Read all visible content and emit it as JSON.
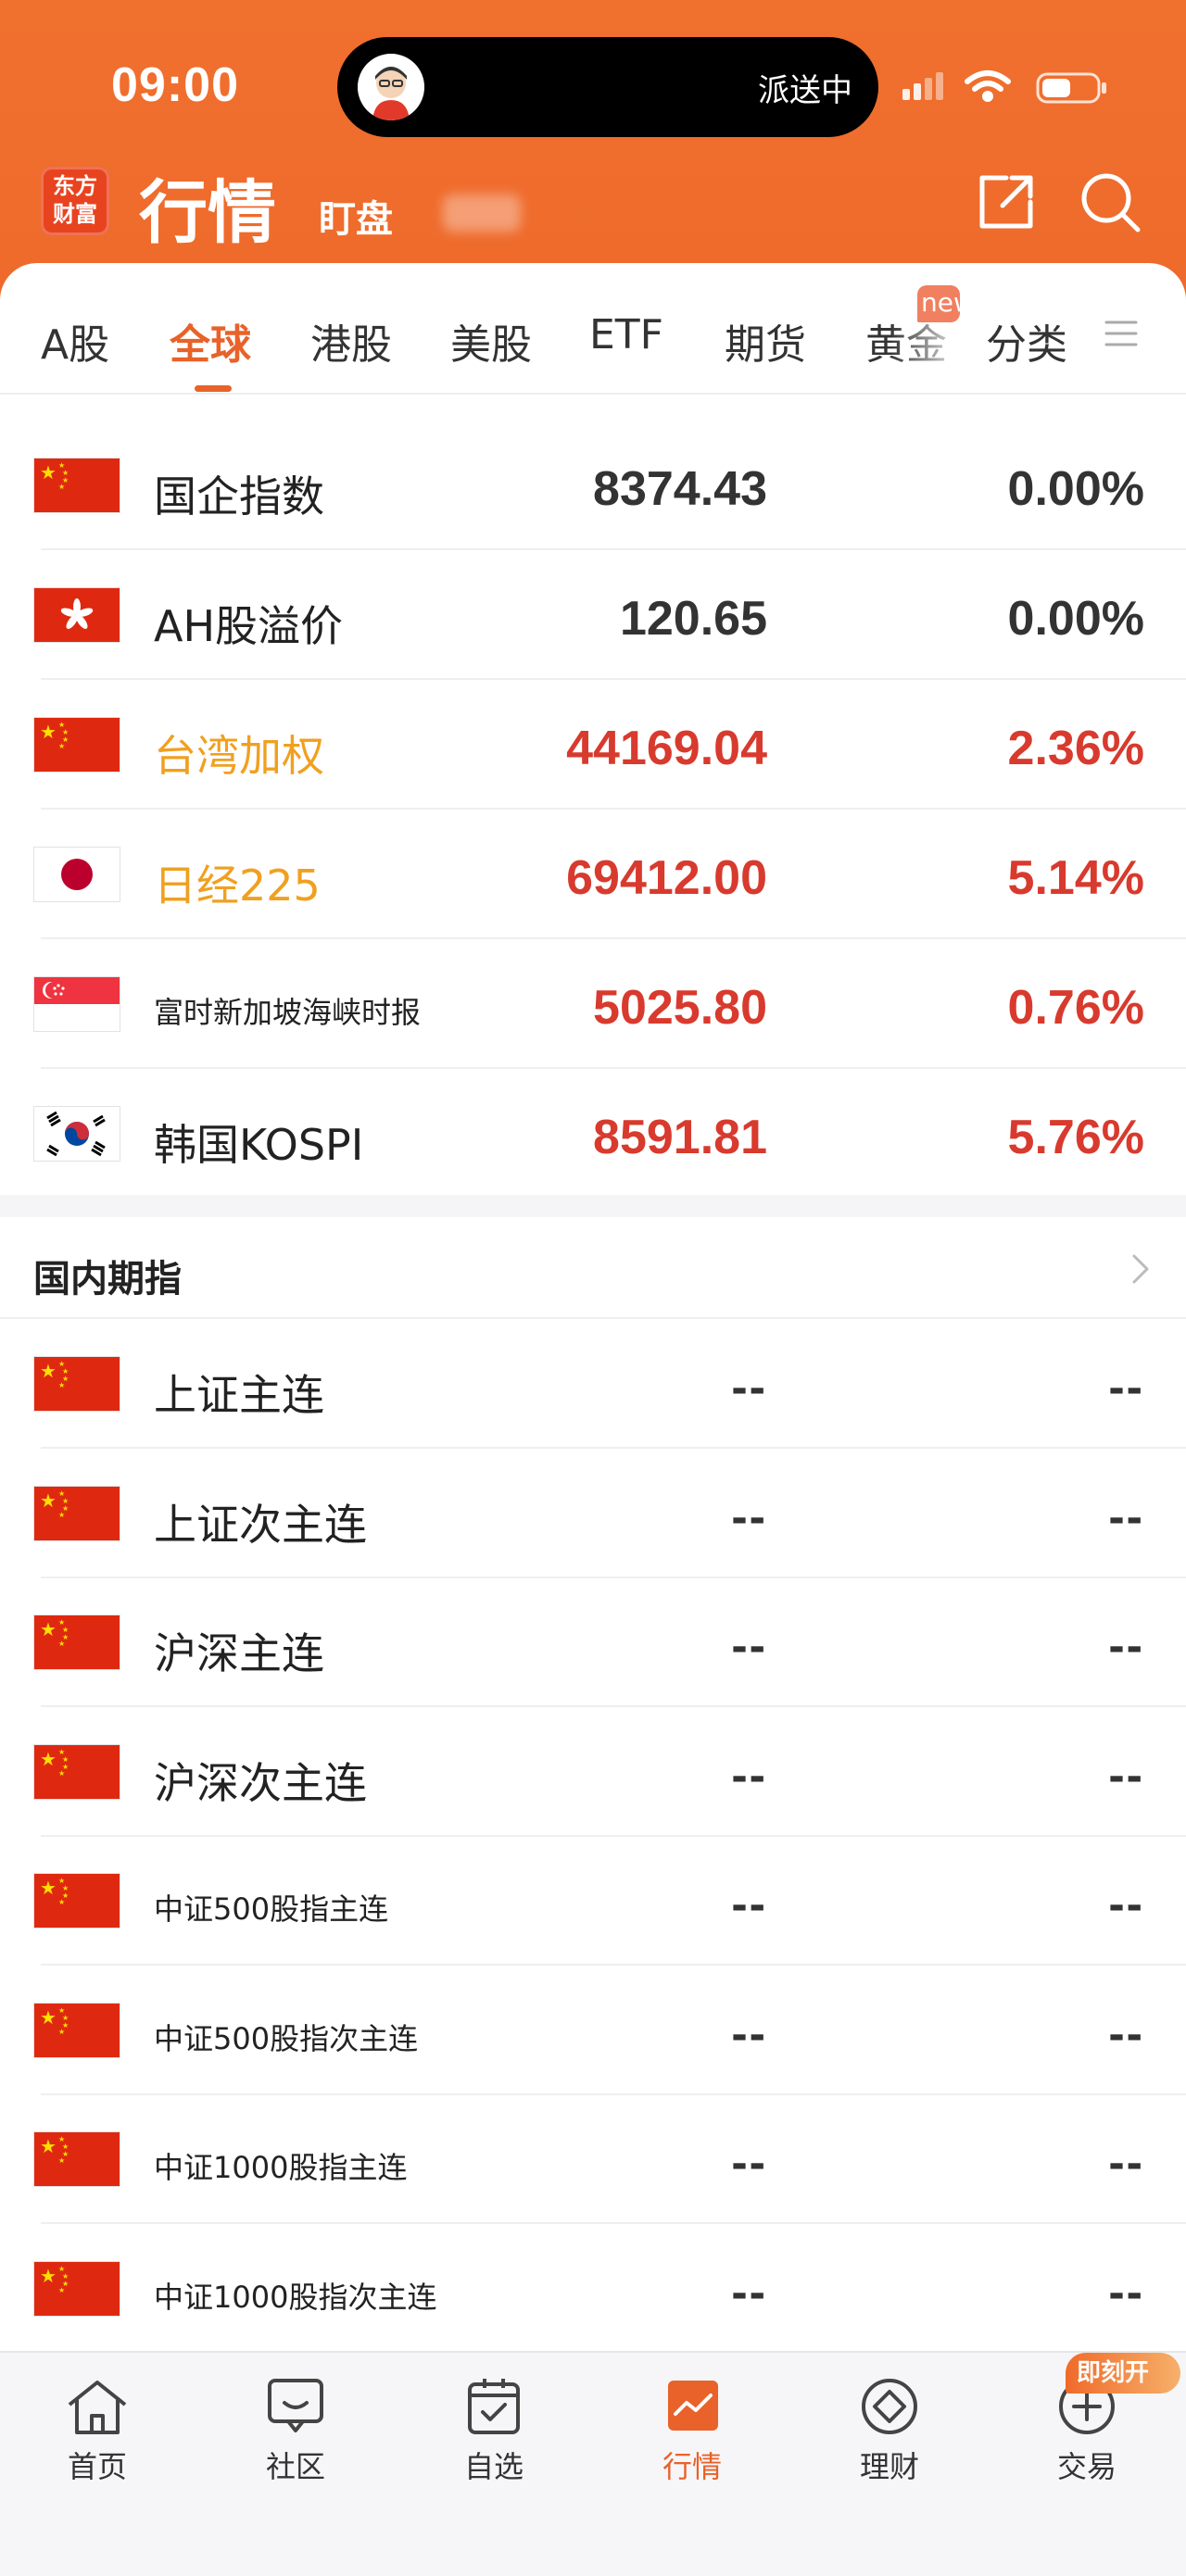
{
  "status_bar": {
    "time": "09:00",
    "island_text": "派送中"
  },
  "header": {
    "logo_line1": "东方",
    "logo_line2": "财富",
    "title": "行情",
    "subtitle": "盯盘"
  },
  "tabs": [
    {
      "label": "A股",
      "active": false
    },
    {
      "label": "全球",
      "active": true
    },
    {
      "label": "港股",
      "active": false
    },
    {
      "label": "美股",
      "active": false
    },
    {
      "label": "ETF",
      "active": false
    },
    {
      "label": "期货",
      "active": false
    },
    {
      "label": "黄金",
      "active": false
    },
    {
      "label": "分类",
      "active": false
    }
  ],
  "new_badge": "new",
  "global_indices": [
    {
      "name": "国企指数",
      "price": "8374.43",
      "change": "0.00%",
      "flag": "cn-flag-icon"
    },
    {
      "name": "AH股溢价",
      "price": "120.65",
      "change": "0.00%",
      "flag": "hk-flag-icon"
    },
    {
      "name": "台湾加权",
      "price": "44169.04",
      "change": "2.36%",
      "flag": "cn-flag-icon"
    },
    {
      "name": "日经225",
      "price": "69412.00",
      "change": "5.14%",
      "flag": "jp-flag-icon"
    },
    {
      "name": "富时新加坡海峡时报",
      "price": "5025.80",
      "change": "0.76%",
      "flag": "sg-flag-icon"
    },
    {
      "name": "韩国KOSPI",
      "price": "8591.81",
      "change": "5.76%",
      "flag": "kr-flag-icon"
    }
  ],
  "futures_section": {
    "title": "国内期指",
    "items": [
      {
        "name": "上证主连",
        "price": "--",
        "change": "--"
      },
      {
        "name": "上证次主连",
        "price": "--",
        "change": "--"
      },
      {
        "name": "沪深主连",
        "price": "--",
        "change": "--"
      },
      {
        "name": "沪深次主连",
        "price": "--",
        "change": "--"
      },
      {
        "name": "中证500股指主连",
        "price": "--",
        "change": "--"
      },
      {
        "name": "中证500股指次主连",
        "price": "--",
        "change": "--"
      },
      {
        "name": "中证1000股指主连",
        "price": "--",
        "change": "--"
      },
      {
        "name": "中证1000股指次主连",
        "price": "--",
        "change": "--"
      }
    ]
  },
  "bottom_nav": [
    {
      "label": "首页",
      "icon": "home-icon",
      "active": false
    },
    {
      "label": "社区",
      "icon": "community-icon",
      "active": false
    },
    {
      "label": "自选",
      "icon": "watchlist-icon",
      "active": false
    },
    {
      "label": "行情",
      "icon": "market-icon",
      "active": true
    },
    {
      "label": "理财",
      "icon": "finance-icon",
      "active": false
    },
    {
      "label": "交易",
      "icon": "trade-icon",
      "active": false
    }
  ],
  "trade_badge": "即刻开",
  "colors": {
    "brand_orange": "#ee6a2c",
    "active_tab": "#e8622a",
    "rise_red": "#d83a2e",
    "highlight_name": "#f0a020"
  }
}
